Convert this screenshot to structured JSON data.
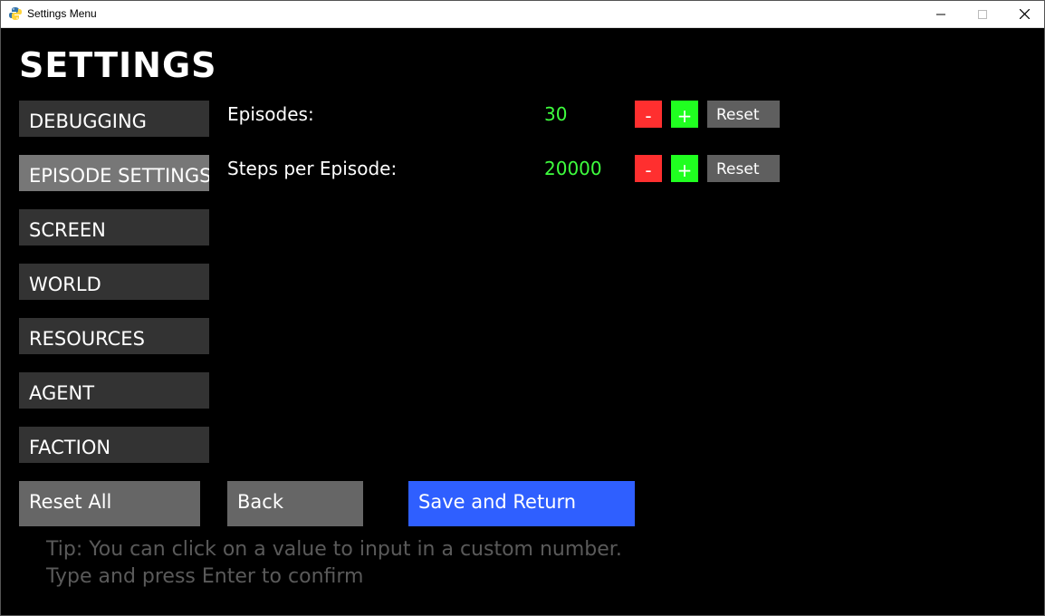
{
  "window": {
    "title": "Settings Menu"
  },
  "page": {
    "heading": "SETTINGS"
  },
  "categories": [
    {
      "label": "DEBUGGING",
      "active": false
    },
    {
      "label": "EPISODE SETTINGS",
      "active": true
    },
    {
      "label": "SCREEN",
      "active": false
    },
    {
      "label": "WORLD",
      "active": false
    },
    {
      "label": "RESOURCES",
      "active": false
    },
    {
      "label": "AGENT",
      "active": false
    },
    {
      "label": "FACTION",
      "active": false
    }
  ],
  "settings": [
    {
      "label": "Episodes:",
      "value": "30",
      "minus": "-",
      "plus": "+",
      "reset": "Reset"
    },
    {
      "label": "Steps per Episode:",
      "value": "20000",
      "minus": "-",
      "plus": "+",
      "reset": "Reset"
    }
  ],
  "actions": {
    "reset_all": "Reset All",
    "back": "Back",
    "save": "Save and Return"
  },
  "tip": {
    "line1": "Tip: You can click on a value to input in a custom number.",
    "line2": "Type and press Enter to confirm"
  },
  "colors": {
    "background": "#000000",
    "category_button": "#333333",
    "category_active": "#777777",
    "value_text": "#3eff3e",
    "minus_button": "#ff2f2f",
    "plus_button": "#20ff20",
    "reset_button": "#5f5f5f",
    "save_button": "#2f5fff",
    "tip_text": "#5a5a5a"
  },
  "icons": {
    "app": "python-snake-icon",
    "minimize": "minimize-icon",
    "maximize": "maximize-icon",
    "close": "close-icon"
  }
}
